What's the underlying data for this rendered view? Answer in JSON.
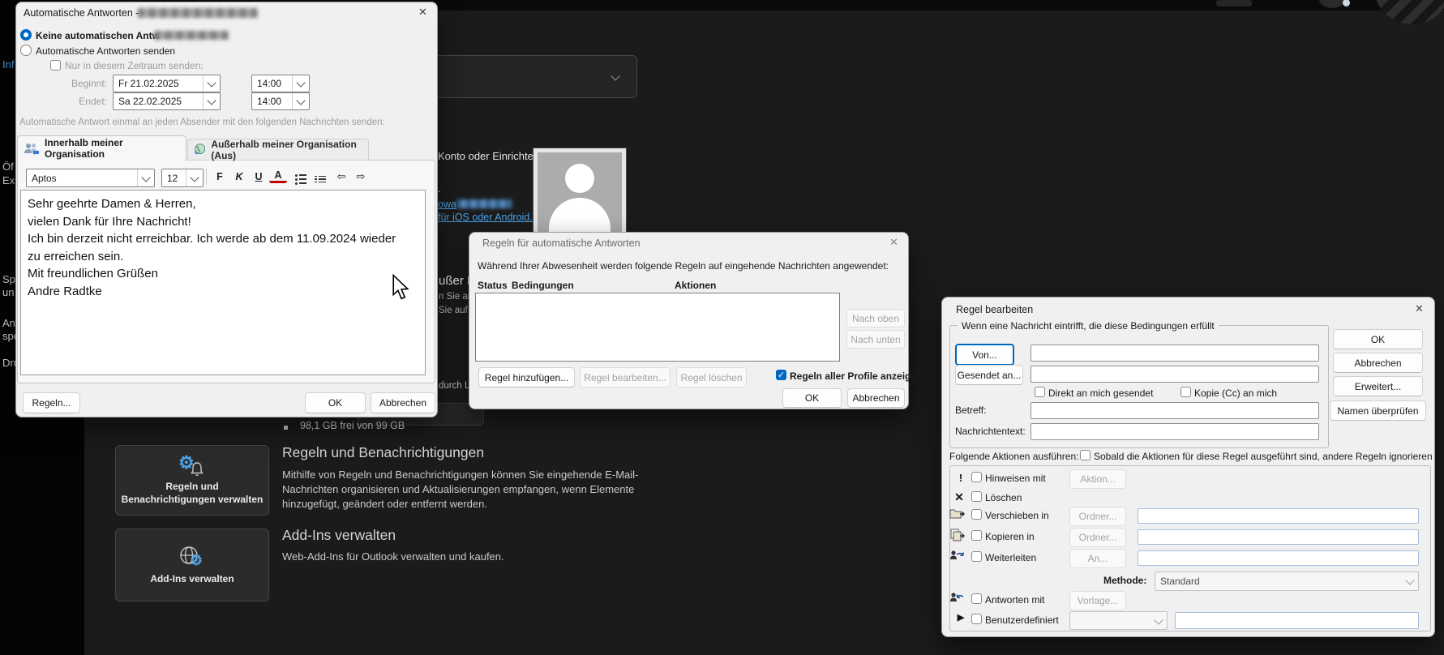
{
  "bg": {
    "sidebar_items": [
      "Inf",
      "Öf",
      "Exp",
      "Sp",
      "un",
      "An",
      "spe",
      "Dru"
    ],
    "strip_fragments": [
      "ußer H",
      "n Sie ar",
      "Sie auf",
      "durch L"
    ],
    "konto_fragment": "Konto oder Einrichten",
    "dot_fragment": ".",
    "owa_link_fragment": "owa",
    "ios_link": "für iOS oder Android.",
    "storage": "98,1 GB frei von 99 GB",
    "rules_heading": "Regeln und Benachrichtigungen",
    "rules_desc": [
      "Mithilfe von Regeln und Benachrichtigungen können Sie eingehende E-Mail-",
      "Nachrichten organisieren und Aktualisierungen empfangen, wenn Elemente",
      "hinzugefügt, geändert oder entfernt werden."
    ],
    "manage_rules_btn": [
      "Regeln und",
      "Benachrichtigungen verwalten"
    ],
    "addins_heading": "Add-Ins verwalten",
    "addins_desc": "Web-Add-Ins für Outlook verwalten und kaufen.",
    "addins_btn": "Add-Ins verwalten"
  },
  "d1": {
    "title": "Automatische Antworten -",
    "r1": "Keine automatischen Antw",
    "r2": "Automatische Antworten senden",
    "cb_range": "Nur in diesem Zeitraum senden:",
    "begins": "Beginnt:",
    "begins_date": "Fr 21.02.2025",
    "begins_time": "14:00",
    "ends": "Endet:",
    "ends_date": "Sa 22.02.2025",
    "ends_time": "14:00",
    "info": "Automatische Antwort einmal an jeden Absender mit den folgenden Nachrichten senden:",
    "tab_in": "Innerhalb meiner Organisation",
    "tab_out": "Außerhalb meiner Organisation (Aus)",
    "font": "Aptos",
    "size": "12",
    "bold": "F",
    "italic": "K",
    "underline": "U",
    "fontcolor": "A",
    "msg": [
      "Sehr geehrte Damen & Herren,",
      "vielen Dank für Ihre Nachricht!",
      "Ich bin derzeit nicht erreichbar. Ich werde ab dem 11.09.2024 wieder",
      "zu erreichen sein.",
      "Mit freundlichen Grüßen",
      "Andre Radtke"
    ],
    "rules": "Regeln...",
    "ok": "OK",
    "cancel": "Abbrechen"
  },
  "d2": {
    "title": "Regeln für automatische Antworten",
    "description": "Während Ihrer Abwesenheit werden folgende Regeln auf eingehende Nachrichten angewendet:",
    "col_status": "Status",
    "col_conditions": "Bedingungen",
    "col_actions": "Aktionen",
    "move_up": "Nach oben",
    "move_down": "Nach unten",
    "add_rule": "Regel hinzufügen...",
    "edit_rule": "Regel bearbeiten...",
    "delete_rule": "Regel löschen",
    "show_all_profiles": "Regeln aller Profile anzeigen",
    "ok": "OK",
    "cancel": "Abbrechen"
  },
  "d3": {
    "title": "Regel bearbeiten",
    "conditions_group": "Wenn eine Nachricht eintrifft, die diese Bedingungen erfüllt",
    "from_button": "Von...",
    "sent_to_button": "Gesendet an...",
    "cb_direct": "Direkt an mich gesendet",
    "cb_copy": "Kopie (Cc) an mich",
    "subject_label": "Betreff:",
    "body_label": "Nachrichtentext:",
    "ok": "OK",
    "cancel": "Abbrechen",
    "advanced": "Erweitert...",
    "check_names": "Namen überprüfen",
    "actions_label": "Folgende Aktionen ausführen:",
    "cb_stop": "Sobald die Aktionen für diese Regel ausgeführt sind, andere Regeln ignorieren",
    "act_alert": "Hinweisen mit",
    "act_alert_btn": "Aktion...",
    "act_delete": "Löschen",
    "act_move": "Verschieben in",
    "act_move_btn": "Ordner...",
    "act_copy": "Kopieren in",
    "act_copy_btn": "Ordner...",
    "act_forward": "Weiterleiten",
    "act_forward_btn": "An...",
    "method_label": "Methode:",
    "method_value": "Standard",
    "act_reply": "Antworten mit",
    "act_reply_btn": "Vorlage...",
    "act_custom": "Benutzerdefiniert"
  },
  "colors": {
    "accent": "#0067c0",
    "link": "#4ba3e8"
  }
}
